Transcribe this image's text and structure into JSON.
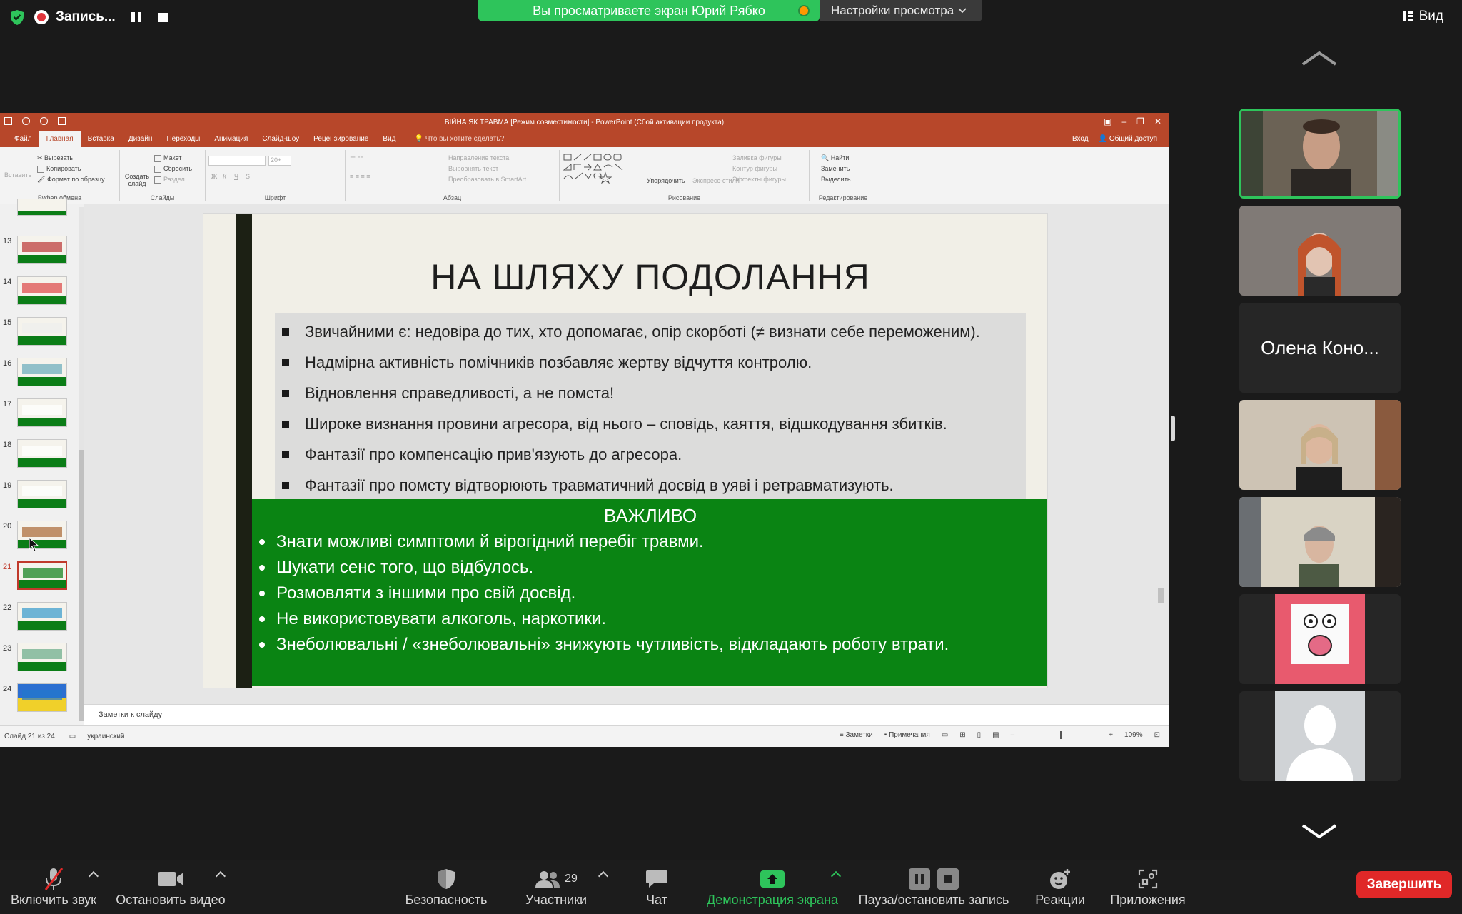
{
  "zoom": {
    "recording_label": "Запись...",
    "viewing_banner": "Вы просматриваете экран Юрий Рябко",
    "view_options": "Настройки просмотра",
    "view_button": "Вид",
    "participants": [
      {
        "type": "video",
        "active": true
      },
      {
        "type": "video"
      },
      {
        "type": "name",
        "name": "Олена Коно..."
      },
      {
        "type": "video"
      },
      {
        "type": "video"
      },
      {
        "type": "video"
      },
      {
        "type": "avatar"
      }
    ],
    "toolbar": {
      "mute": "Включить звук",
      "video": "Остановить видео",
      "security": "Безопасность",
      "participants": "Участники",
      "participants_count": "29",
      "chat": "Чат",
      "share": "Демонстрация экрана",
      "pause_record": "Пауза/остановить запись",
      "reactions": "Реакции",
      "apps": "Приложения",
      "end": "Завершить"
    }
  },
  "ppt": {
    "window_title": "ВІЙНА ЯК ТРАВМА [Режим совместимости] - PowerPoint (Сбой активации продукта)",
    "tabs": [
      "Файл",
      "Главная",
      "Вставка",
      "Дизайн",
      "Переходы",
      "Анимация",
      "Слайд-шоу",
      "Рецензирование",
      "Вид"
    ],
    "active_tab": "Главная",
    "tell_me": "Что вы хотите сделать?",
    "signin": "Вход",
    "share": "Общий доступ",
    "ribbon": {
      "paste": "Вставить",
      "cut": "Вырезать",
      "copy": "Копировать",
      "format_painter": "Формат по образцу",
      "clipboard": "Буфер обмена",
      "new_slide": "Создать слайд",
      "layout": "Макет",
      "reset": "Сбросить",
      "section": "Раздел",
      "slides": "Слайды",
      "font_size": "20+",
      "font": "Шрифт",
      "text_direction": "Направление текста",
      "align_text": "Выровнять текст",
      "smartart": "Преобразовать в SmartArt",
      "paragraph": "Абзац",
      "arrange": "Упорядочить",
      "quick_styles": "Экспресс-стили",
      "shape_fill": "Заливка фигуры",
      "shape_outline": "Контур фигуры",
      "shape_effects": "Эффекты фигуры",
      "drawing": "Рисование",
      "find": "Найти",
      "replace": "Заменить",
      "select": "Выделить",
      "editing": "Редактирование"
    },
    "thumbnails": [
      {
        "num": "13",
        "current": false
      },
      {
        "num": "14",
        "current": false
      },
      {
        "num": "15",
        "current": false
      },
      {
        "num": "16",
        "current": false
      },
      {
        "num": "17",
        "current": false
      },
      {
        "num": "18",
        "current": false
      },
      {
        "num": "19",
        "current": false
      },
      {
        "num": "20",
        "current": false
      },
      {
        "num": "21",
        "current": true
      },
      {
        "num": "22",
        "current": false
      },
      {
        "num": "23",
        "current": false
      },
      {
        "num": "24",
        "current": false
      }
    ],
    "slide": {
      "title": "НА ШЛЯХУ ПОДОЛАННЯ",
      "bullets": [
        "Звичайними є: недовіра до тих, хто допомагає, опір скорботі (≠ визнати себе переможеним).",
        "Надмірна активність помічників позбавляє жертву відчуття контролю.",
        "Відновлення справедливості, а не помста!",
        "Широке визнання провини агресора, від нього – сповідь, каяття, відшкодування збитків.",
        "Фантазії про компенсацію прив'язують до агресора.",
        "Фантазії про помсту відтворюють травматичний досвід в уяві і ретравматизують."
      ],
      "important_heading": "ВАЖЛИВО",
      "important_items": [
        "Знати можливі симптоми й вірогідний перебіг травми.",
        "Шукати сенс того, що відбулось.",
        "Розмовляти з іншими про свій досвід.",
        "Не використовувати алкоголь, наркотики.",
        "Знеболювальні / «знеболювальні» знижують чутливість, відкладають роботу втрати."
      ]
    },
    "notes_placeholder": "Заметки к слайду",
    "status": {
      "slide_of": "Слайд 21 из 24",
      "language": "украинский",
      "notes": "Заметки",
      "comments": "Примечания",
      "zoom": "109%"
    }
  }
}
